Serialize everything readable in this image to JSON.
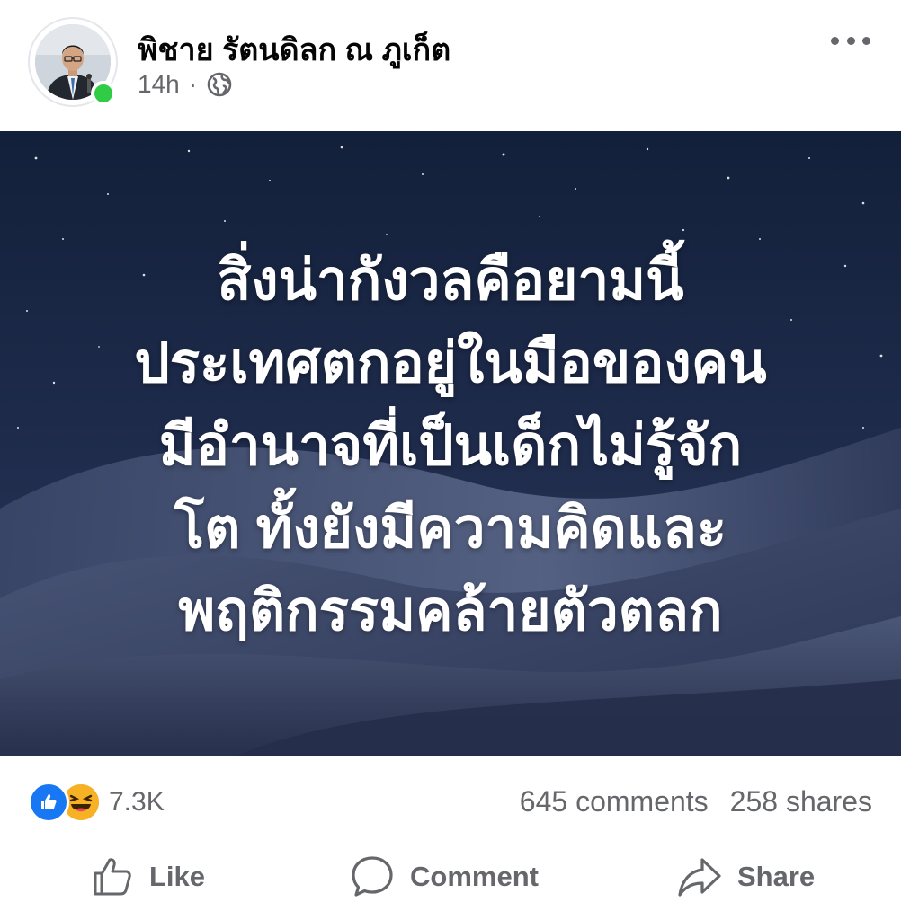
{
  "post": {
    "author": {
      "name": "พิชาย รัตนดิลก ณ ภูเก็ต",
      "online": true
    },
    "time": "14h",
    "separator": "·",
    "audience_icon": "globe-icon",
    "more_icon": "more-horizontal-icon",
    "image": {
      "background": "starry-night-desert",
      "text_lines": [
        "สิ่งน่ากังวลคือยามนี้",
        "ประเทศตกอยู่ในมือของคน",
        "มีอำนาจที่เป็นเด็กไม่รู้จัก",
        "โต ทั้งยังมีความคิดและ",
        "พฤติกรรมคล้ายตัวตลก"
      ]
    },
    "stats": {
      "reaction_icons": [
        "like-reaction-icon",
        "haha-reaction-icon"
      ],
      "reactions_count": "7.3K",
      "comments": "645 comments",
      "shares": "258 shares"
    },
    "actions": {
      "like": "Like",
      "comment": "Comment",
      "share": "Share"
    }
  },
  "colors": {
    "secondary_text": "#65676b",
    "online": "#31cc46",
    "like_blue": "#1877f2",
    "haha_yellow": "#f7b125"
  }
}
